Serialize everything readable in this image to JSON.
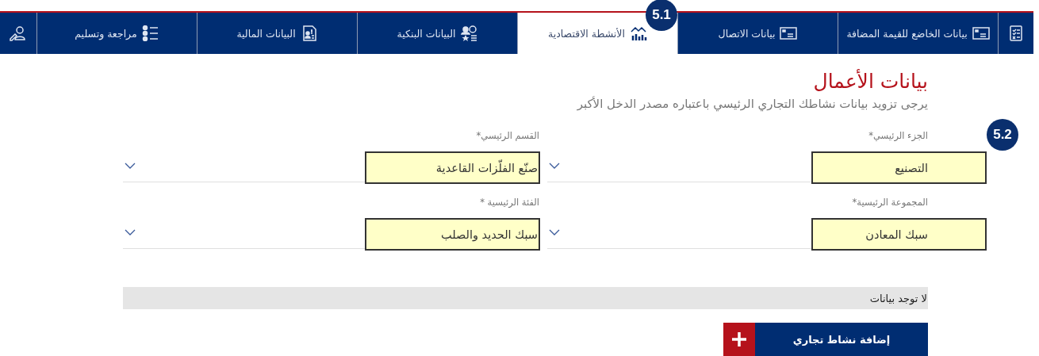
{
  "tabs": [
    {
      "kind": "icon",
      "selected": false
    },
    {
      "kind": "text",
      "label": "بيانات الخاضع للقيمة المضافة",
      "selected": false
    },
    {
      "kind": "text",
      "label": "بيانات الاتصال",
      "selected": false
    },
    {
      "kind": "text",
      "label": "الأنشطة الاقتصادية",
      "selected": true,
      "badge": "5.1"
    },
    {
      "kind": "text",
      "label": "البيانات البنكية",
      "selected": false
    },
    {
      "kind": "text",
      "label": "البيانات المالية",
      "selected": false
    },
    {
      "kind": "text",
      "label": "مراجعة وتسليم",
      "selected": false
    },
    {
      "kind": "icon",
      "selected": false
    }
  ],
  "form": {
    "title": "بيانات الأعمال",
    "subtitle": "يرجى تزويد بيانات نشاطك التجاري الرئيسي باعتباره مصدر الدخل الأكبر",
    "fields": [
      {
        "label": "الجزء الرئيسي*",
        "value": "التصنيع",
        "highlighted": true,
        "badge": "5.2"
      },
      {
        "label": "القسم الرئيسي*",
        "value": "صنّع الفلّزات القاعدية",
        "highlighted": true
      },
      {
        "label": "المجموعة الرئيسية*",
        "value": "سبك المعادن",
        "highlighted": true
      },
      {
        "label": "الفئة الرئيسية *",
        "value": "سبك الحديد والصلب",
        "highlighted": true
      }
    ]
  },
  "table": {
    "empty_message": "لا توجد بيانات"
  },
  "add_button": {
    "label": "إضافة نشاط تجاري"
  }
}
